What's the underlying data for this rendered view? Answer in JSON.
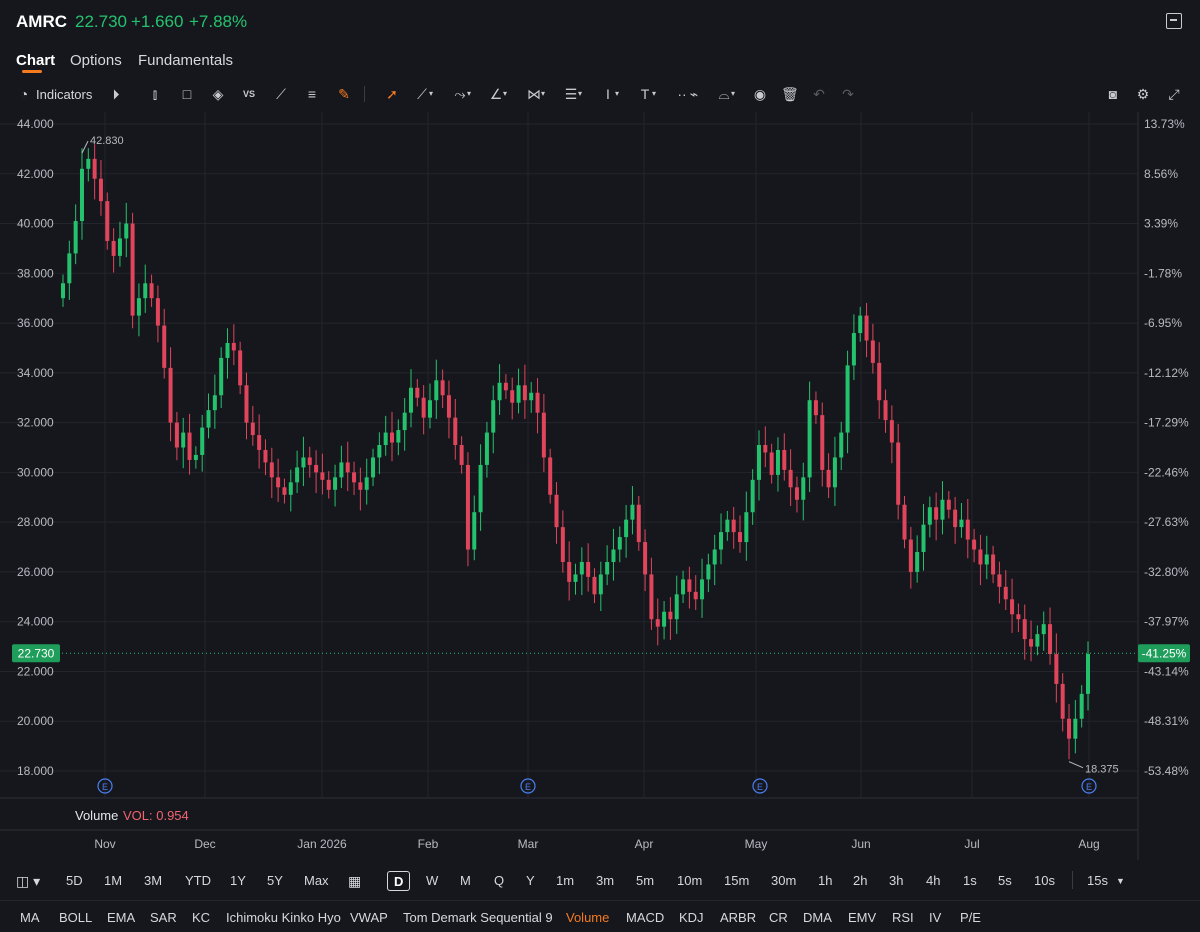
{
  "header": {
    "ticker": "AMRC",
    "last_price": "22.730",
    "change": "+1.660",
    "change_pct": "+7.88%"
  },
  "tabs": [
    "Chart",
    "Options",
    "Fundamentals"
  ],
  "toolbar": {
    "indicators_label": "Indicators",
    "icons": [
      "replay-icon",
      "candle-type-icon",
      "square-icon",
      "layers-icon",
      "vs-compare-icon",
      "chart-line-icon",
      "text-lines-icon",
      "pen-icon",
      "cursor-icon",
      "trendline-icon",
      "ray-icon",
      "angle-icon",
      "pattern-icon",
      "fib-icon",
      "vertical-line-icon",
      "text-icon",
      "brush-icon",
      "shapes-icon",
      "eye-icon",
      "trash-icon",
      "undo-icon",
      "redo-icon",
      "camera-icon",
      "settings-icon"
    ]
  },
  "accent": "#f47a20",
  "up_color": "#25c26e",
  "down_color": "#e0455c",
  "volume": {
    "label": "Volume",
    "value": "VOL: 0.954"
  },
  "ranges": [
    "5D",
    "1M",
    "3M",
    "YTD",
    "1Y",
    "5Y",
    "Max",
    "D",
    "W",
    "M",
    "Q",
    "Y",
    "1m",
    "3m",
    "5m",
    "10m",
    "15m",
    "30m",
    "1h",
    "2h",
    "3h",
    "4h",
    "1s",
    "5s",
    "10s",
    "15s"
  ],
  "selected_range": "D",
  "indicators": [
    "MA",
    "BOLL",
    "EMA",
    "SAR",
    "KC",
    "Ichimoku Kinko Hyo",
    "VWAP",
    "Tom Demark Sequential 9",
    "Volume",
    "MACD",
    "KDJ",
    "ARBR",
    "CR",
    "DMA",
    "EMV",
    "RSI",
    "IV",
    "P/E"
  ],
  "active_indicator": "Volume",
  "chart_data": {
    "type": "candlestick",
    "ylim": [
      17.2,
      44.6
    ],
    "y_ticks": [
      "44.000",
      "42.000",
      "40.000",
      "38.000",
      "36.000",
      "34.000",
      "32.000",
      "30.000",
      "28.000",
      "26.000",
      "24.000",
      "22.000",
      "20.000",
      "18.000"
    ],
    "pct_ticks": [
      "13.73%",
      "8.56%",
      "3.39%",
      "-1.78%",
      "-6.95%",
      "-12.12%",
      "-17.29%",
      "-22.46%",
      "-27.63%",
      "-32.80%",
      "-37.97%",
      "-43.14%",
      "-48.31%",
      "-53.48%"
    ],
    "x_labels": [
      "Nov",
      "Dec",
      "Jan 2026",
      "Feb",
      "Mar",
      "Apr",
      "May",
      "Jun",
      "Jul",
      "Aug"
    ],
    "current_price_label": "22.730",
    "current_pct_label": "-41.25%",
    "high_annotation": "42.830",
    "low_annotation": "18.375",
    "earnings_marker": "E",
    "grid": true,
    "close": [
      37.6,
      38.8,
      40.1,
      42.2,
      42.6,
      41.8,
      40.9,
      39.3,
      38.7,
      39.4,
      40.0,
      36.3,
      37.0,
      37.6,
      37.0,
      35.9,
      34.2,
      32.0,
      31.0,
      31.6,
      30.5,
      30.7,
      31.8,
      32.5,
      33.1,
      34.6,
      35.2,
      34.9,
      33.5,
      32.0,
      31.5,
      30.9,
      30.4,
      29.8,
      29.4,
      29.1,
      29.6,
      30.2,
      30.6,
      30.3,
      30.0,
      29.7,
      29.3,
      29.8,
      30.4,
      30.0,
      29.6,
      29.3,
      29.8,
      30.6,
      31.1,
      31.6,
      31.2,
      31.7,
      32.4,
      33.4,
      33.0,
      32.2,
      32.9,
      33.7,
      33.1,
      32.2,
      31.1,
      30.3,
      26.9,
      28.4,
      30.3,
      31.6,
      32.9,
      33.6,
      33.3,
      32.8,
      33.5,
      32.9,
      33.2,
      32.4,
      30.6,
      29.1,
      27.8,
      26.4,
      25.6,
      25.9,
      26.4,
      25.8,
      25.1,
      25.9,
      26.4,
      26.9,
      27.4,
      28.1,
      28.7,
      27.2,
      25.9,
      24.1,
      23.8,
      24.4,
      24.1,
      25.1,
      25.7,
      25.2,
      24.9,
      25.7,
      26.3,
      26.9,
      27.6,
      28.1,
      27.6,
      27.2,
      28.4,
      29.7,
      31.1,
      30.8,
      29.9,
      30.9,
      30.1,
      29.4,
      28.9,
      29.8,
      32.9,
      32.3,
      30.1,
      29.4,
      30.6,
      31.6,
      34.3,
      35.6,
      36.3,
      35.3,
      34.4,
      32.9,
      32.1,
      31.2,
      28.7,
      27.3,
      26.0,
      26.8,
      27.9,
      28.6,
      28.1,
      28.9,
      28.5,
      27.8,
      28.1,
      27.3,
      26.9,
      26.3,
      26.7,
      25.9,
      25.4,
      24.9,
      24.3,
      24.1,
      23.3,
      23.0,
      23.5,
      23.9,
      22.7,
      21.5,
      20.1,
      19.3,
      20.1,
      21.1,
      22.7
    ],
    "open": [
      37.0,
      37.6,
      38.8,
      40.1,
      42.2,
      42.6,
      41.8,
      40.9,
      39.3,
      38.7,
      39.4,
      40.0,
      36.3,
      37.0,
      37.6,
      37.0,
      35.9,
      34.2,
      32.0,
      31.0,
      31.6,
      30.5,
      30.7,
      31.8,
      32.5,
      33.1,
      34.6,
      35.2,
      34.9,
      33.5,
      32.0,
      31.5,
      30.9,
      30.4,
      29.8,
      29.4,
      29.1,
      29.6,
      30.2,
      30.6,
      30.3,
      30.0,
      29.7,
      29.3,
      29.8,
      30.4,
      30.0,
      29.6,
      29.3,
      29.8,
      30.6,
      31.1,
      31.6,
      31.2,
      31.7,
      32.4,
      33.4,
      33.0,
      32.2,
      32.9,
      33.7,
      33.1,
      32.2,
      31.1,
      30.3,
      26.9,
      28.4,
      30.3,
      31.6,
      32.9,
      33.6,
      33.3,
      32.8,
      33.5,
      32.9,
      33.2,
      32.4,
      30.6,
      29.1,
      27.8,
      26.4,
      25.6,
      25.9,
      26.4,
      25.8,
      25.1,
      25.9,
      26.4,
      26.9,
      27.4,
      28.1,
      28.7,
      27.2,
      25.9,
      24.1,
      23.8,
      24.4,
      24.1,
      25.1,
      25.7,
      25.2,
      24.9,
      25.7,
      26.3,
      26.9,
      27.6,
      28.1,
      27.6,
      27.2,
      28.4,
      29.7,
      31.1,
      30.8,
      29.9,
      30.9,
      30.1,
      29.4,
      28.9,
      29.8,
      32.9,
      32.3,
      30.1,
      29.4,
      30.6,
      31.6,
      34.3,
      35.6,
      36.3,
      35.3,
      34.4,
      32.9,
      32.1,
      31.2,
      28.7,
      27.3,
      26.0,
      26.8,
      27.9,
      28.6,
      28.1,
      28.9,
      28.5,
      27.8,
      28.1,
      27.3,
      26.9,
      26.3,
      26.7,
      25.9,
      25.4,
      24.9,
      24.3,
      24.1,
      23.3,
      23.0,
      23.5,
      23.9,
      22.7,
      21.5,
      20.1,
      19.3,
      20.1,
      21.1
    ]
  }
}
